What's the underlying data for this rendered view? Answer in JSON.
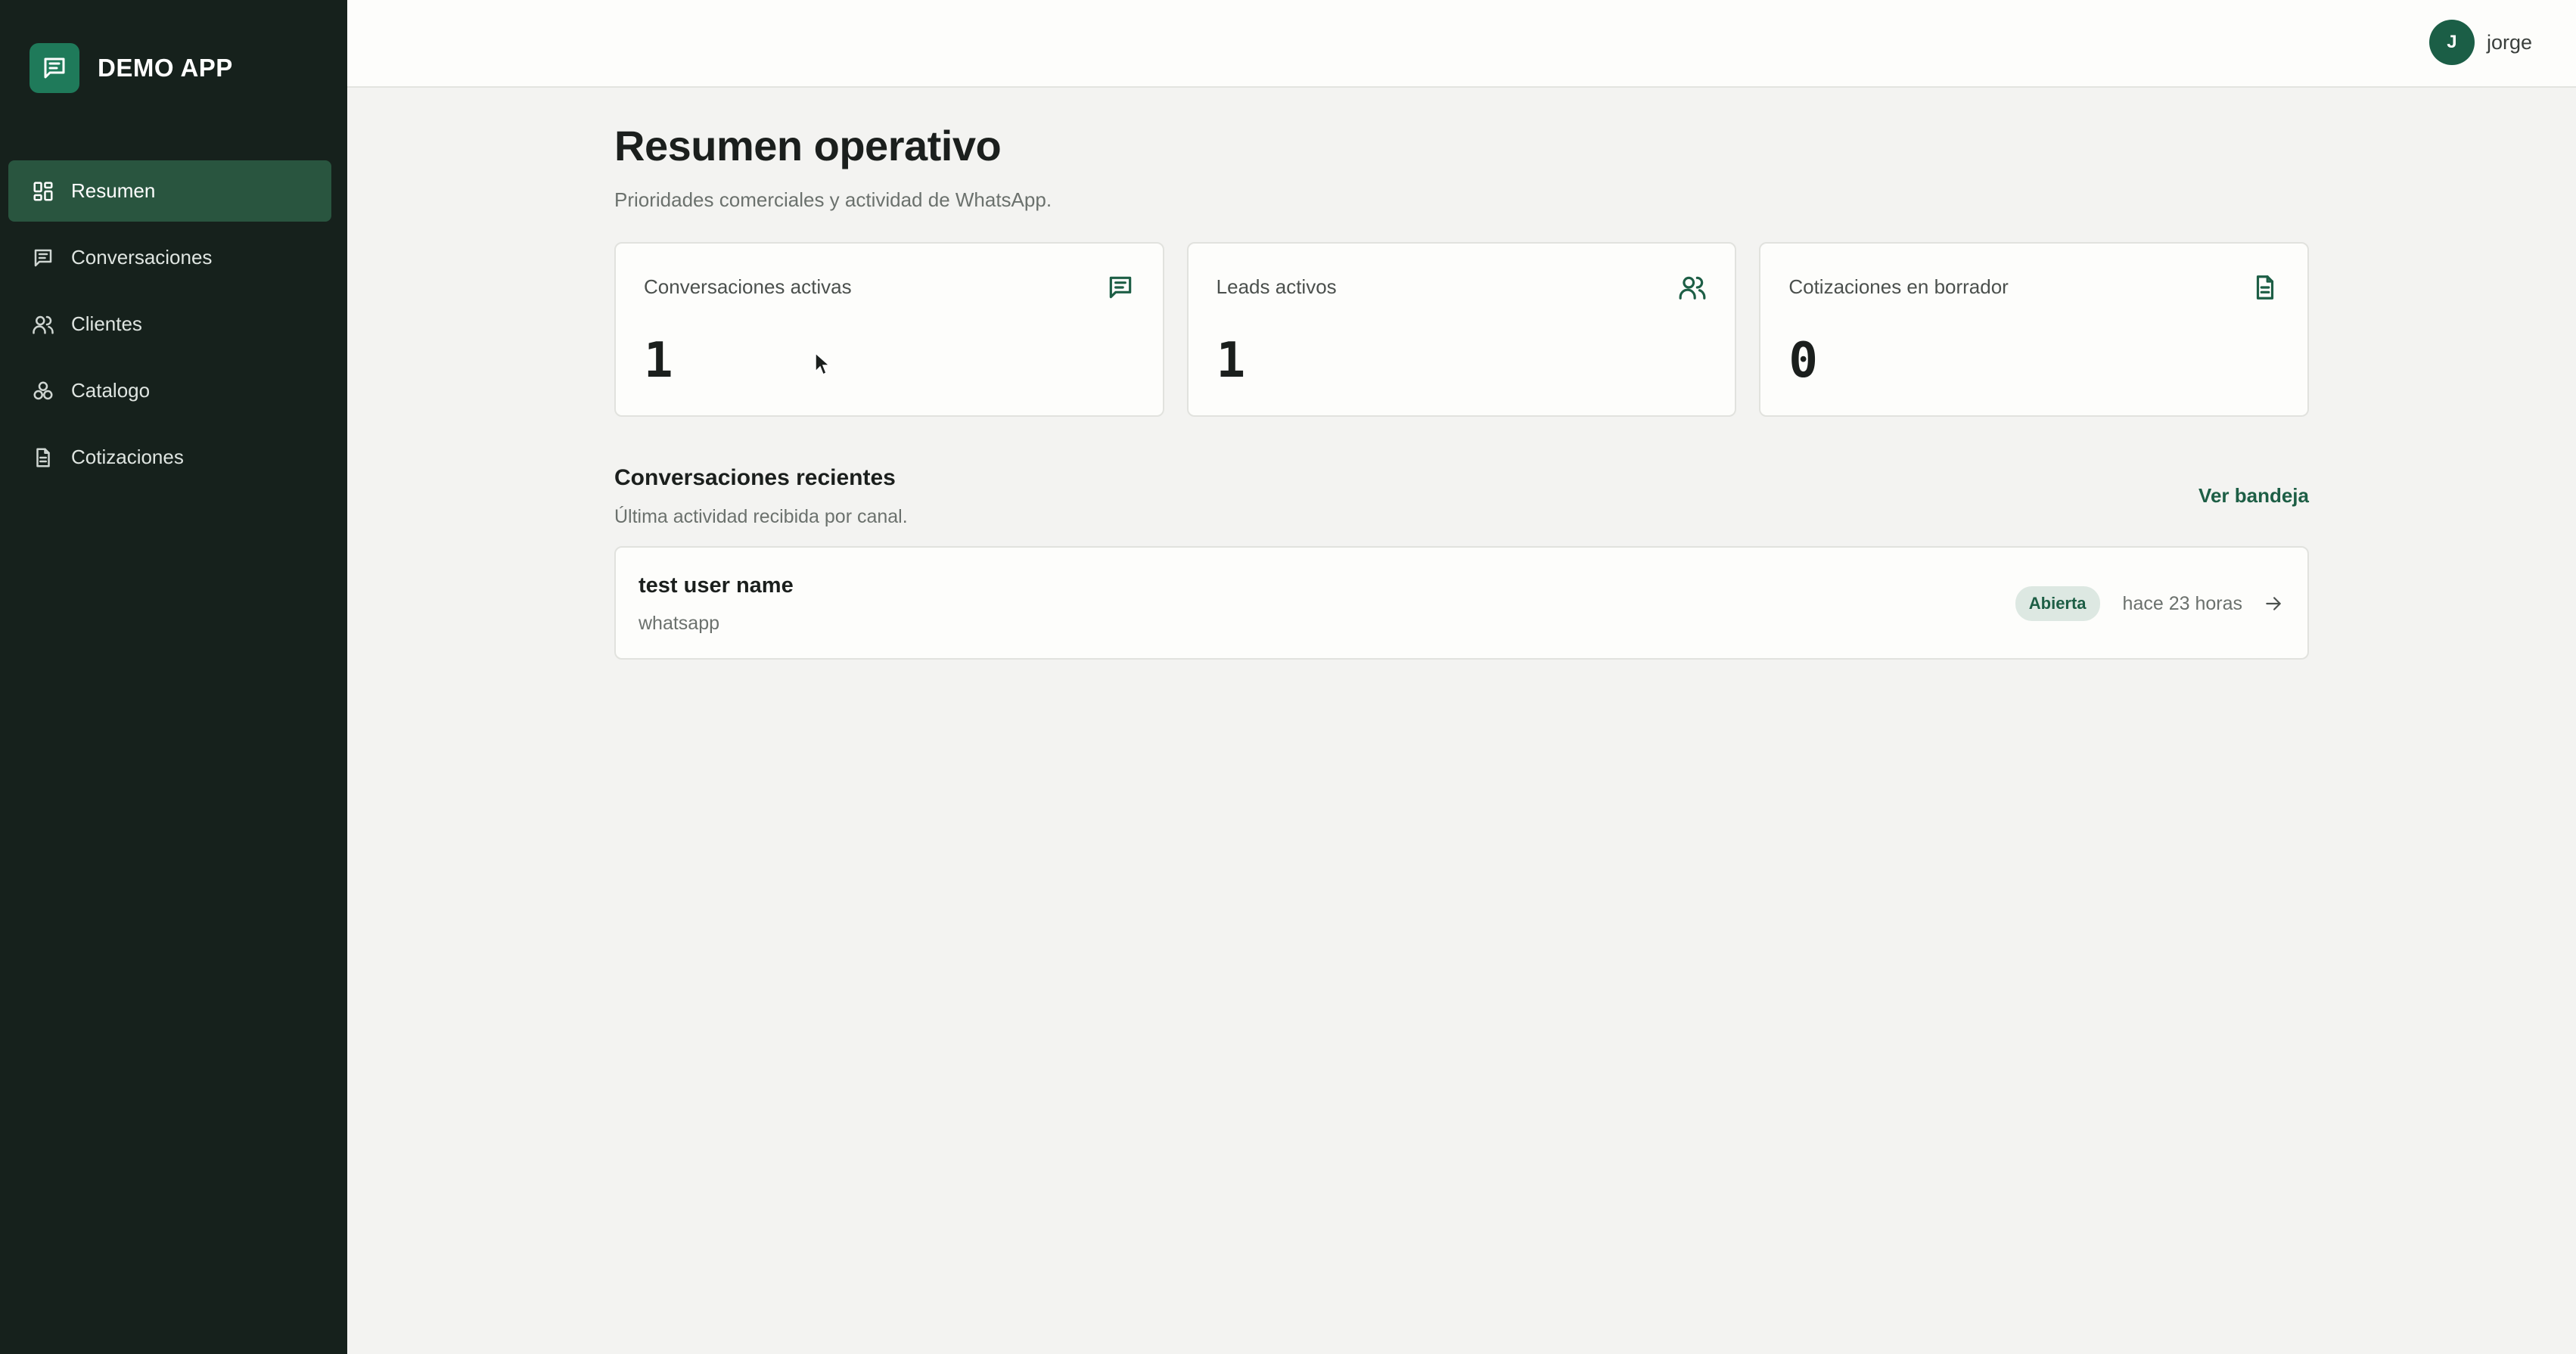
{
  "app": {
    "name": "DEMO APP"
  },
  "sidebar": {
    "items": [
      {
        "label": "Resumen",
        "icon": "grid-icon",
        "active": true
      },
      {
        "label": "Conversaciones",
        "icon": "message-icon",
        "active": false
      },
      {
        "label": "Clientes",
        "icon": "users-icon",
        "active": false
      },
      {
        "label": "Catalogo",
        "icon": "boxes-icon",
        "active": false
      },
      {
        "label": "Cotizaciones",
        "icon": "document-icon",
        "active": false
      }
    ]
  },
  "user": {
    "initial": "J",
    "name": "jorge"
  },
  "page": {
    "title": "Resumen operativo",
    "subtitle": "Prioridades comerciales y actividad de WhatsApp."
  },
  "stats": [
    {
      "label": "Conversaciones activas",
      "value": "1",
      "icon": "message-icon"
    },
    {
      "label": "Leads activos",
      "value": "1",
      "icon": "users-icon"
    },
    {
      "label": "Cotizaciones en borrador",
      "value": "0",
      "icon": "document-icon"
    }
  ],
  "recent": {
    "title": "Conversaciones recientes",
    "subtitle": "Última actividad recibida por canal.",
    "link": "Ver bandeja",
    "items": [
      {
        "name": "test user name",
        "channel": "whatsapp",
        "status": "Abierta",
        "time": "hace 23 horas"
      }
    ]
  },
  "colors": {
    "sidebar_bg": "#16211c",
    "active_nav": "#29553f",
    "brand": "#1f7a5a",
    "accent": "#1d5e45",
    "badge_bg": "#dde8e2",
    "page_bg": "#f3f3f1"
  }
}
